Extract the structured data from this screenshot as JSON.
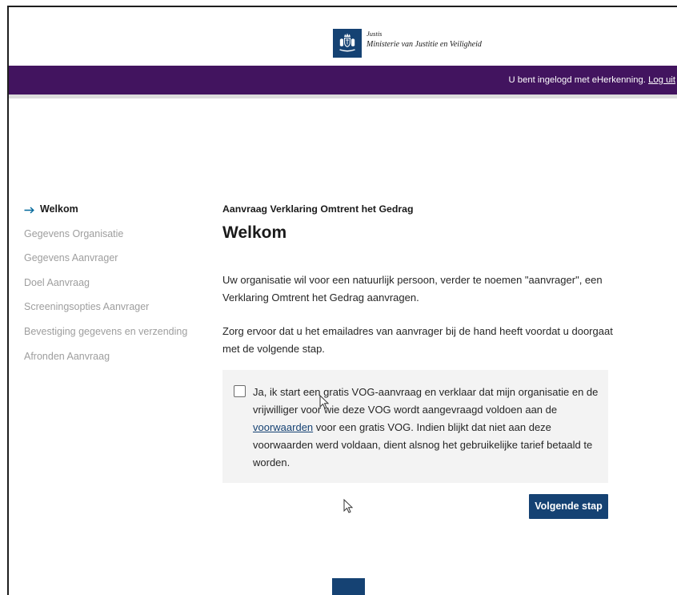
{
  "header": {
    "logo": {
      "icon": "government-emblem-icon",
      "org_short": "Justis",
      "org_full": "Ministerie van Justitie en Veiligheid"
    }
  },
  "topbar": {
    "login_status": "U bent ingelogd met eHerkenning.",
    "logout_label": "Log uit"
  },
  "sidebar": {
    "active_marker_icon": "arrow-right-icon",
    "items": [
      {
        "label": "Welkom",
        "active": true
      },
      {
        "label": "Gegevens Organisatie",
        "active": false
      },
      {
        "label": "Gegevens Aanvrager",
        "active": false
      },
      {
        "label": "Doel Aanvraag",
        "active": false
      },
      {
        "label": "Screeningsopties Aanvrager",
        "active": false
      },
      {
        "label": "Bevestiging gegevens en verzending",
        "active": false
      },
      {
        "label": "Afronden Aanvraag",
        "active": false
      }
    ]
  },
  "main": {
    "pretitle": "Aanvraag Verklaring Omtrent het Gedrag",
    "title": "Welkom",
    "paragraphs": [
      "Uw organisatie wil voor een natuurlijk persoon, verder te noemen \"aanvrager\", een Verklaring Omtrent het Gedrag aanvragen.",
      "Zorg ervoor dat u het emailadres van aanvrager bij de hand heeft voordat u doorgaat met de volgende stap."
    ],
    "consent": {
      "checked": false,
      "text_before": "Ja, ik start een gratis VOG-aanvraag en verklaar dat mijn organisatie en de vrijwilliger voor wie deze VOG wordt aangevraagd voldoen aan de",
      "link_label": "voorwaarden",
      "text_after": "voor een gratis VOG. Indien blijkt dat niet aan deze voorwaarden werd voldaan, dient alsnog het gebruikelijke tarief betaald te worden."
    },
    "next_button_label": "Volgende stap"
  },
  "colors": {
    "header_bar": "#42145f",
    "primary": "#154273",
    "link": "#154273",
    "panel_background": "#f3f3f3",
    "nav_inactive": "#9e9e9e",
    "nav_arrow": "#01689b"
  }
}
